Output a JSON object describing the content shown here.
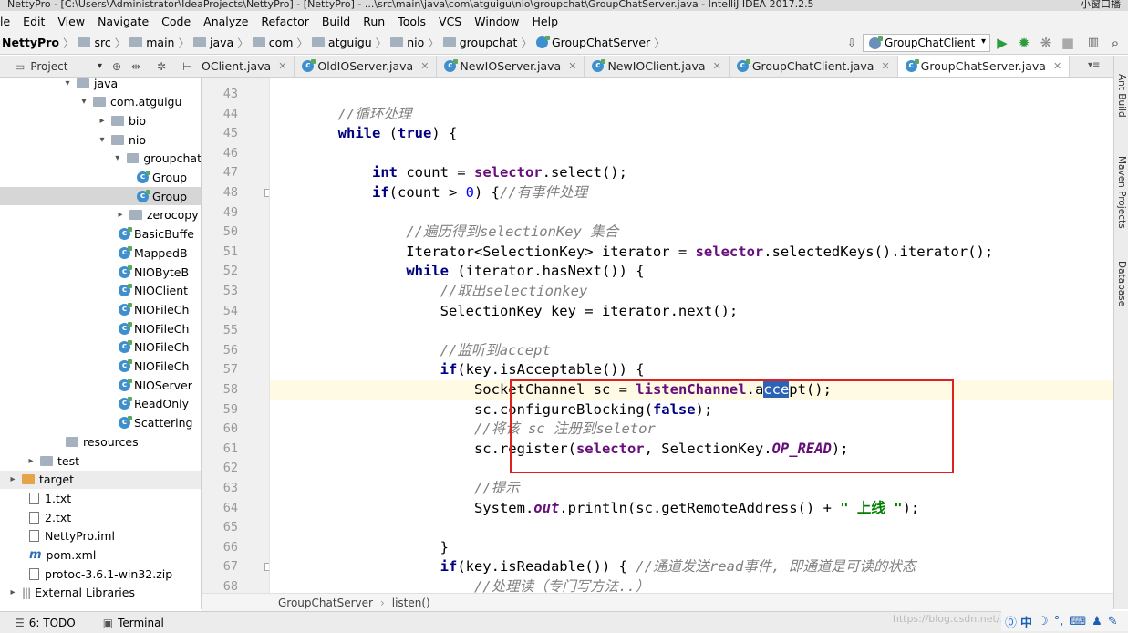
{
  "window": {
    "title": "NettyPro - [C:\\Users\\Administrator\\IdeaProjects\\NettyPro] - [NettyPro] - ...\\src\\main\\java\\com\\atguigu\\nio\\groupchat\\GroupChatServer.java - IntelliJ IDEA 2017.2.5",
    "right_text": "小窗口播"
  },
  "menu": [
    "File",
    "Edit",
    "View",
    "Navigate",
    "Code",
    "Analyze",
    "Refactor",
    "Build",
    "Run",
    "Tools",
    "VCS",
    "Window",
    "Help"
  ],
  "menu_display": [
    "le",
    "Edit",
    "View",
    "Navigate",
    "Code",
    "Analyze",
    "Refactor",
    "Build",
    "Run",
    "Tools",
    "VCS",
    "Window",
    "Help"
  ],
  "breadcrumbs": [
    "NettyPro",
    "src",
    "main",
    "java",
    "com",
    "atguigu",
    "nio",
    "groupchat",
    "GroupChatServer"
  ],
  "run_config": "GroupChatClient",
  "project_panel": {
    "title": "Project"
  },
  "tree": [
    {
      "label": "java",
      "depth": 0,
      "arrow": "▾",
      "icon": "folder"
    },
    {
      "label": "com.atguigu",
      "depth": 1,
      "arrow": "▾",
      "icon": "package"
    },
    {
      "label": "bio",
      "depth": 2,
      "arrow": "▸",
      "icon": "package"
    },
    {
      "label": "nio",
      "depth": 2,
      "arrow": "▾",
      "icon": "package"
    },
    {
      "label": "groupchat",
      "depth": 3,
      "arrow": "▾",
      "icon": "package"
    },
    {
      "label": "Group",
      "depth": 4,
      "arrow": "",
      "icon": "class"
    },
    {
      "label": "Group",
      "depth": 4,
      "arrow": "",
      "icon": "class",
      "selected": true
    },
    {
      "label": "zerocopy",
      "depth": 3,
      "arrow": "▸",
      "icon": "package"
    },
    {
      "label": "BasicBuffe",
      "depth": 3,
      "arrow": "",
      "icon": "class"
    },
    {
      "label": "MappedB",
      "depth": 3,
      "arrow": "",
      "icon": "class"
    },
    {
      "label": "NIOByteB",
      "depth": 3,
      "arrow": "",
      "icon": "class"
    },
    {
      "label": "NIOClient",
      "depth": 3,
      "arrow": "",
      "icon": "class"
    },
    {
      "label": "NIOFileCh",
      "depth": 3,
      "arrow": "",
      "icon": "class"
    },
    {
      "label": "NIOFileCh",
      "depth": 3,
      "arrow": "",
      "icon": "class"
    },
    {
      "label": "NIOFileCh",
      "depth": 3,
      "arrow": "",
      "icon": "class"
    },
    {
      "label": "NIOFileCh",
      "depth": 3,
      "arrow": "",
      "icon": "class"
    },
    {
      "label": "NIOServer",
      "depth": 3,
      "arrow": "",
      "icon": "class"
    },
    {
      "label": "ReadOnly",
      "depth": 3,
      "arrow": "",
      "icon": "class"
    },
    {
      "label": "Scattering",
      "depth": 3,
      "arrow": "",
      "icon": "class"
    },
    {
      "label": "resources",
      "depth": 0,
      "arrow": "",
      "icon": "folder"
    },
    {
      "label": "test",
      "depth": -1,
      "arrow": "▸",
      "icon": "folder"
    },
    {
      "label": "target",
      "depth": -2,
      "arrow": "▸",
      "icon": "folder-orange",
      "selected_light": true
    },
    {
      "label": "1.txt",
      "depth": -1,
      "arrow": "",
      "icon": "file"
    },
    {
      "label": "2.txt",
      "depth": -1,
      "arrow": "",
      "icon": "file"
    },
    {
      "label": "NettyPro.iml",
      "depth": -1,
      "arrow": "",
      "icon": "file"
    },
    {
      "label": "pom.xml",
      "depth": -1,
      "arrow": "",
      "icon": "maven"
    },
    {
      "label": "protoc-3.6.1-win32.zip",
      "depth": -1,
      "arrow": "",
      "icon": "file"
    },
    {
      "label": "External Libraries",
      "depth": -2,
      "arrow": "▸",
      "icon": "library"
    }
  ],
  "tabs": [
    {
      "label": "OClient.java",
      "active": false
    },
    {
      "label": "OldIOServer.java",
      "active": false
    },
    {
      "label": "NewIOServer.java",
      "active": false
    },
    {
      "label": "NewIOClient.java",
      "active": false
    },
    {
      "label": "GroupChatClient.java",
      "active": false
    },
    {
      "label": "GroupChatServer.java",
      "active": true
    }
  ],
  "code_lines": [
    {
      "n": "43",
      "tokens": []
    },
    {
      "n": "44",
      "tokens": [
        [
          "        ",
          ""
        ],
        [
          "//循环处理",
          "c"
        ]
      ]
    },
    {
      "n": "45",
      "tokens": [
        [
          "        ",
          ""
        ],
        [
          "while",
          "k"
        ],
        [
          " (",
          ""
        ],
        [
          "true",
          "k"
        ],
        [
          ") {",
          ""
        ]
      ]
    },
    {
      "n": "46",
      "tokens": []
    },
    {
      "n": "47",
      "tokens": [
        [
          "            ",
          ""
        ],
        [
          "int",
          "k"
        ],
        [
          " count = ",
          ""
        ],
        [
          "selector",
          "m"
        ],
        [
          ".select();",
          ""
        ]
      ]
    },
    {
      "n": "48",
      "tokens": [
        [
          "            ",
          ""
        ],
        [
          "if",
          "k"
        ],
        [
          "(count > ",
          ""
        ],
        [
          "0",
          "n"
        ],
        [
          ") {",
          ""
        ],
        [
          "//有事件处理",
          "c"
        ]
      ]
    },
    {
      "n": "49",
      "tokens": []
    },
    {
      "n": "50",
      "tokens": [
        [
          "                ",
          ""
        ],
        [
          "//遍历得到selectionKey 集合",
          "c"
        ]
      ]
    },
    {
      "n": "51",
      "tokens": [
        [
          "                Iterator<SelectionKey> iterator = ",
          ""
        ],
        [
          "selector",
          "m"
        ],
        [
          ".selectedKeys().iterator();",
          ""
        ]
      ]
    },
    {
      "n": "52",
      "tokens": [
        [
          "                ",
          ""
        ],
        [
          "while",
          "k"
        ],
        [
          " (iterator.hasNext()) {",
          ""
        ]
      ]
    },
    {
      "n": "53",
      "tokens": [
        [
          "                    ",
          ""
        ],
        [
          "//取出selectionkey",
          "c"
        ]
      ]
    },
    {
      "n": "54",
      "tokens": [
        [
          "                    SelectionKey key = iterator.next();",
          ""
        ]
      ]
    },
    {
      "n": "55",
      "tokens": []
    },
    {
      "n": "56",
      "tokens": [
        [
          "                    ",
          ""
        ],
        [
          "//监听到accept",
          "c"
        ]
      ]
    },
    {
      "n": "57",
      "tokens": [
        [
          "                    ",
          ""
        ],
        [
          "if",
          "k"
        ],
        [
          "(key.isAcceptable()) {",
          ""
        ]
      ]
    },
    {
      "n": "58",
      "tokens": [
        [
          "                        SocketChannel sc = ",
          ""
        ],
        [
          "listenChannel",
          "m"
        ],
        [
          ".a",
          ""
        ],
        [
          "cce",
          "sel-text"
        ],
        [
          "pt();",
          ""
        ]
      ],
      "current": true
    },
    {
      "n": "59",
      "tokens": [
        [
          "                        sc.configureBlocking(",
          ""
        ],
        [
          "false",
          "k"
        ],
        [
          ");",
          ""
        ]
      ]
    },
    {
      "n": "60",
      "tokens": [
        [
          "                        ",
          ""
        ],
        [
          "//将该 sc 注册到seletor",
          "c"
        ]
      ]
    },
    {
      "n": "61",
      "tokens": [
        [
          "                        sc.register(",
          ""
        ],
        [
          "selector",
          "m"
        ],
        [
          ", SelectionKey.",
          ""
        ],
        [
          "OP_READ",
          "fi"
        ],
        [
          ");",
          ""
        ]
      ]
    },
    {
      "n": "62",
      "tokens": []
    },
    {
      "n": "63",
      "tokens": [
        [
          "                        ",
          ""
        ],
        [
          "//提示",
          "c"
        ]
      ]
    },
    {
      "n": "64",
      "tokens": [
        [
          "                        System.",
          ""
        ],
        [
          "out",
          "fi"
        ],
        [
          ".println(sc.getRemoteAddress() + ",
          ""
        ],
        [
          "\" 上线 \"",
          "st"
        ],
        [
          ");",
          ""
        ]
      ]
    },
    {
      "n": "65",
      "tokens": []
    },
    {
      "n": "66",
      "tokens": [
        [
          "                    }",
          ""
        ]
      ]
    },
    {
      "n": "67",
      "tokens": [
        [
          "                    ",
          ""
        ],
        [
          "if",
          "k"
        ],
        [
          "(key.isReadable()) { ",
          ""
        ],
        [
          "//通道发送read事件, 即通道是可读的状态",
          "c"
        ]
      ]
    },
    {
      "n": "68",
      "tokens": [
        [
          "                        ",
          ""
        ],
        [
          "//处理读（专门写方法..）",
          "c"
        ]
      ]
    }
  ],
  "right_tools": [
    "Ant Build",
    "Maven Projects",
    "Database"
  ],
  "editor_breadcrumb": [
    "GroupChatServer",
    "listen()"
  ],
  "status": {
    "todo": "6: TODO",
    "terminal": "Terminal",
    "watermark": "https://blog.csdn.net/..."
  },
  "ime": {
    "label": "中"
  }
}
